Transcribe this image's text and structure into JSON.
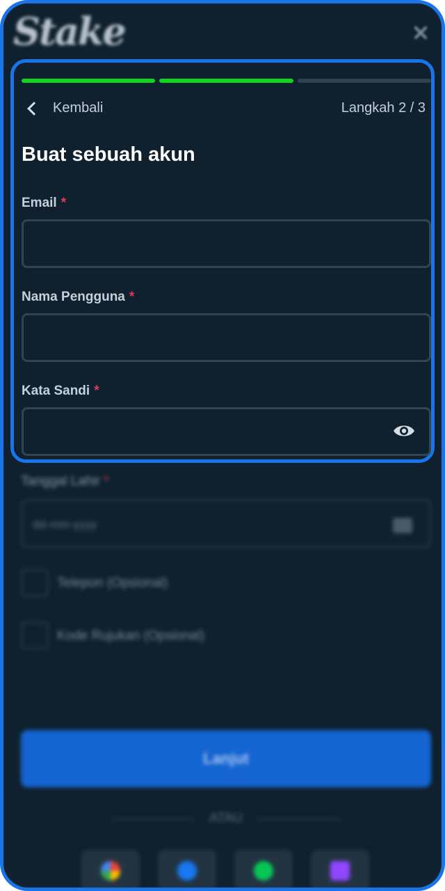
{
  "header": {
    "logo_text": "Stake"
  },
  "progress": {
    "current_step": 2,
    "total_steps": 3
  },
  "nav": {
    "back_label": "Kembali",
    "step_label": "Langkah 2 / 3"
  },
  "form": {
    "title": "Buat sebuah akun",
    "required_mark": "*",
    "fields": [
      {
        "label": "Email",
        "value": "",
        "placeholder": ""
      },
      {
        "label": "Nama Pengguna",
        "value": "",
        "placeholder": ""
      },
      {
        "label": "Kata Sandi",
        "value": "",
        "placeholder": ""
      }
    ]
  },
  "blurred": {
    "dob_label": "Tanggal Lahir",
    "dob_placeholder": "dd-mm-yyyy",
    "phone_optional": "Telepon (Opsional)",
    "referral_optional": "Kode Rujukan (Opsional)",
    "next_button": "Lanjut",
    "or_label": "ATAU"
  },
  "colors": {
    "background": "#0f212e",
    "highlight_border": "#1a73e8",
    "progress_done": "#12d41f",
    "progress_todo": "#2e4351",
    "required": "#e03b5c",
    "primary_button": "#1464d2"
  },
  "icons": {
    "back": "chevron-left-icon",
    "password_toggle": "eye-icon",
    "close": "close-icon",
    "calendar": "calendar-icon"
  }
}
